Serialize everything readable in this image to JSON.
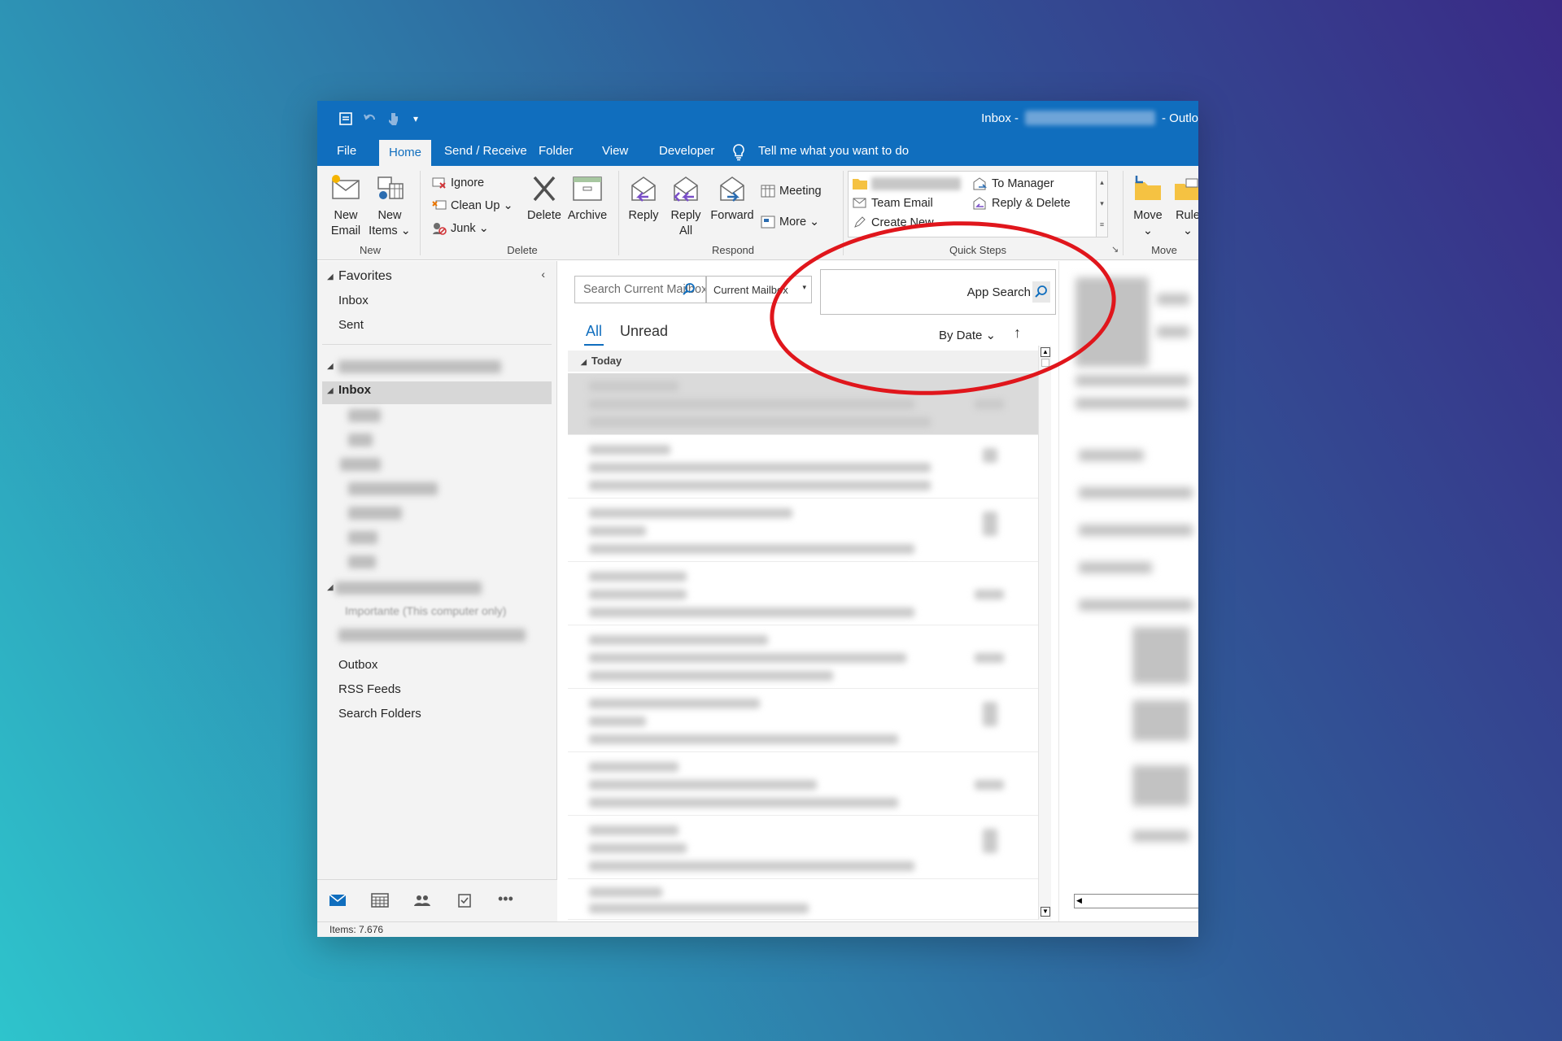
{
  "titlebar": {
    "title_prefix": "Inbox -",
    "title_suffix": "-  Outlo"
  },
  "tabs": [
    {
      "label": "File"
    },
    {
      "label": "Home"
    },
    {
      "label": "Send / Receive"
    },
    {
      "label": "Folder"
    },
    {
      "label": "View"
    },
    {
      "label": "Developer"
    }
  ],
  "tell_me": "Tell me what you want to do",
  "ribbon": {
    "new_email": "New Email",
    "new_email_l1": "New",
    "new_email_l2": "Email",
    "new_items_l1": "New",
    "new_items_l2": "Items",
    "group_new": "New",
    "ignore": "Ignore",
    "clean_up": "Clean Up",
    "junk": "Junk",
    "delete": "Delete",
    "archive": "Archive",
    "group_delete": "Delete",
    "reply": "Reply",
    "reply_all_l1": "Reply",
    "reply_all_l2": "All",
    "forward": "Forward",
    "meeting": "Meeting",
    "more": "More",
    "group_respond": "Respond",
    "qs_team_email": "Team Email",
    "qs_create_new": "Create New",
    "qs_to_manager": "To Manager",
    "qs_reply_delete": "Reply & Delete",
    "group_quick_steps": "Quick Steps",
    "move": "Move",
    "rules": "Rule",
    "group_move": "Move"
  },
  "nav": {
    "favorites": "Favorites",
    "fav_inbox": "Inbox",
    "fav_sent": "Sent",
    "inbox": "Inbox",
    "sub_partial": "Importante (This computer only)",
    "outbox": "Outbox",
    "rss_feeds": "RSS Feeds",
    "search_folders": "Search Folders"
  },
  "list": {
    "search_placeholder": "Search Current Mailbox",
    "scope": "Current Mailbox",
    "app_search": "App Search",
    "filter_all": "All",
    "filter_unread": "Unread",
    "sort": "By Date",
    "group_today": "Today"
  },
  "status": {
    "items": "Items: 7.676"
  },
  "colors": {
    "accent": "#106ebe",
    "annotation": "#e0161c"
  }
}
